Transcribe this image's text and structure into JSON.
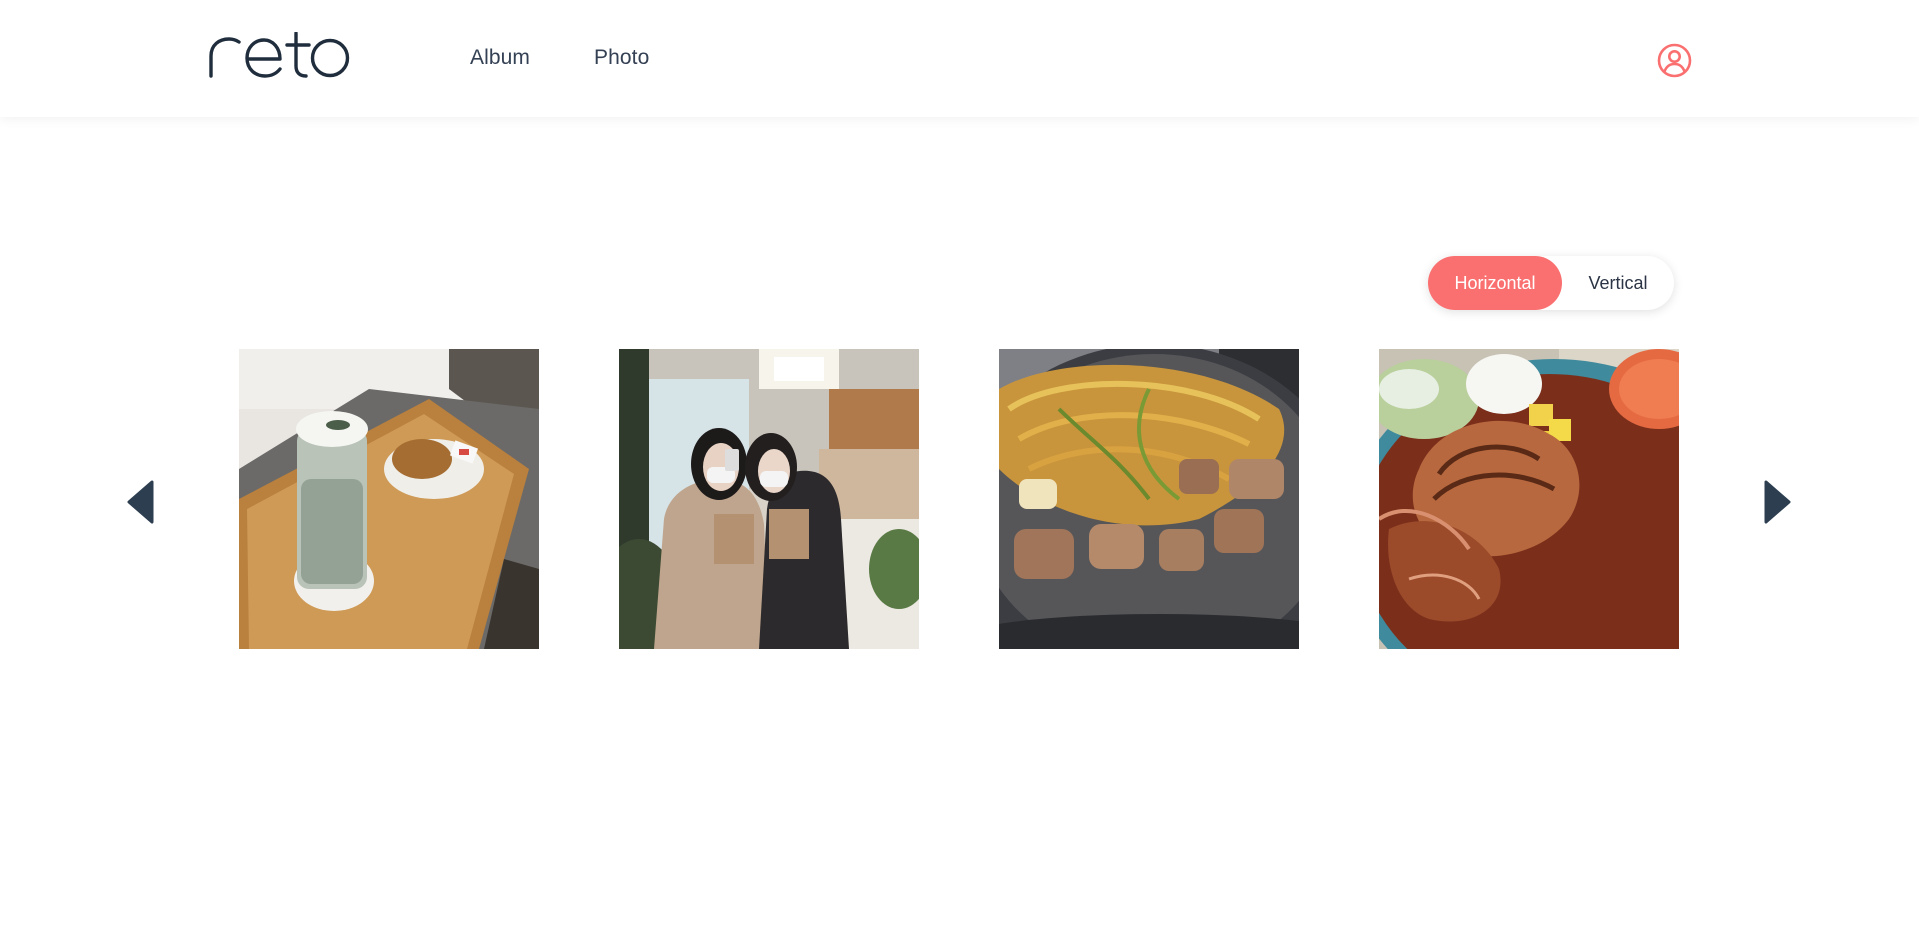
{
  "header": {
    "logo_text": "reto",
    "nav": [
      {
        "label": "Album"
      },
      {
        "label": "Photo"
      }
    ],
    "user_icon": "user-circle-icon"
  },
  "view_toggle": {
    "options": [
      "Horizontal",
      "Vertical"
    ],
    "selected": "Horizontal"
  },
  "carousel": {
    "prev_icon": "caret-left-icon",
    "next_icon": "caret-right-icon",
    "photos": [
      {
        "subject": "matcha latte drink on wooden tray with pastry"
      },
      {
        "subject": "two friends with masks holding paper bags in a cafe"
      },
      {
        "subject": "grilled pork and bean sprouts on a hot plate"
      },
      {
        "subject": "pork cutlet with brown sauce, rice and salad"
      }
    ]
  },
  "colors": {
    "accent": "#fa7070",
    "text": "#344054",
    "arrow": "#2c3e50",
    "logo": "#1f2d3d"
  }
}
